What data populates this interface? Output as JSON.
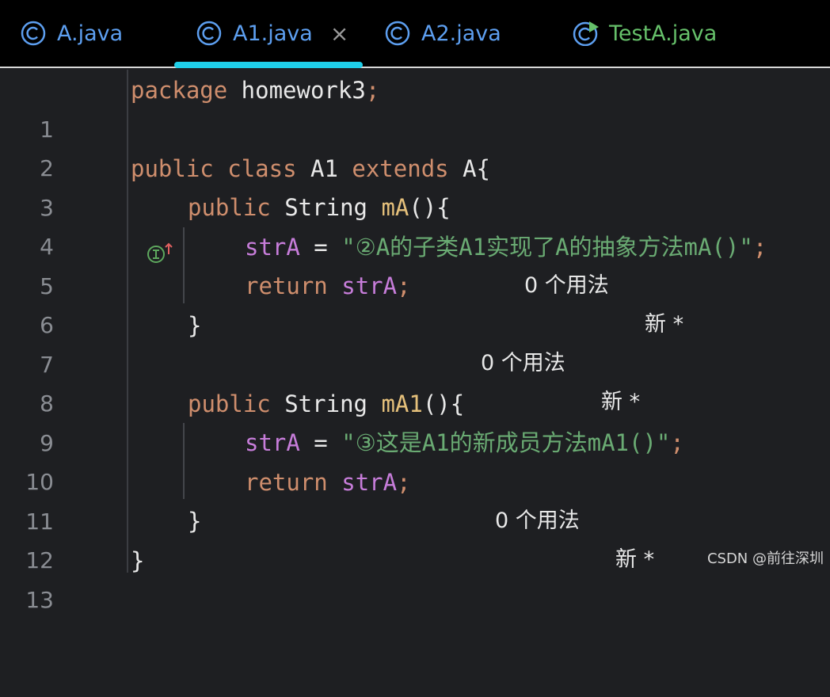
{
  "tabs": [
    {
      "label": "A.java"
    },
    {
      "label": "A1.java",
      "close": "×"
    },
    {
      "label": "A2.java"
    },
    {
      "label": "TestA.java"
    }
  ],
  "lines": [
    "1",
    "2",
    "3",
    "4",
    "5",
    "6",
    "7",
    "8",
    "9",
    "10",
    "11",
    "12",
    "13"
  ],
  "code": {
    "l1": {
      "kw": "package",
      "rest": " homework3",
      "semi": ";"
    },
    "l3": {
      "kw1": "public",
      "kw2": "class",
      "name": " A1 ",
      "kw3": "extends",
      "parent": " A{",
      "hint_usage": "0 个用法",
      "hint_new": "新 *"
    },
    "l4": {
      "kw": "public",
      "type": " String ",
      "fn": "mA",
      "rest": "(){",
      "hint_usage": "0 个用法",
      "hint_new": "新 *"
    },
    "l5": {
      "field": "strA",
      "op": " = ",
      "str": "\"②A的子类A1实现了A的抽象方法mA()\"",
      "semi": ";"
    },
    "l6": {
      "kw": "return",
      "field": "strA",
      "semi": ";"
    },
    "l7": {
      "brace": "}"
    },
    "l9": {
      "kw": "public",
      "type": " String ",
      "fn": "mA1",
      "rest": "(){",
      "hint_usage": "0 个用法",
      "hint_new": "新 *"
    },
    "l10": {
      "field": "strA",
      "op": " = ",
      "str": "\"③这是A1的新成员方法mA1()\"",
      "semi": ";"
    },
    "l11": {
      "kw": "return",
      "field": "strA",
      "semi": ";"
    },
    "l12": {
      "brace": "}"
    },
    "l13": {
      "brace": "}"
    }
  },
  "colors": {
    "accent": "#1fd0ea",
    "keyword": "#cf8e6d",
    "string": "#6aab73",
    "field": "#c77dda",
    "function": "#e5c07b"
  },
  "icons": {
    "class_tab": "class-c-icon",
    "test_tab": "run-class-icon",
    "gutter": "implements-method-icon"
  },
  "watermark": "CSDN @前往深圳"
}
